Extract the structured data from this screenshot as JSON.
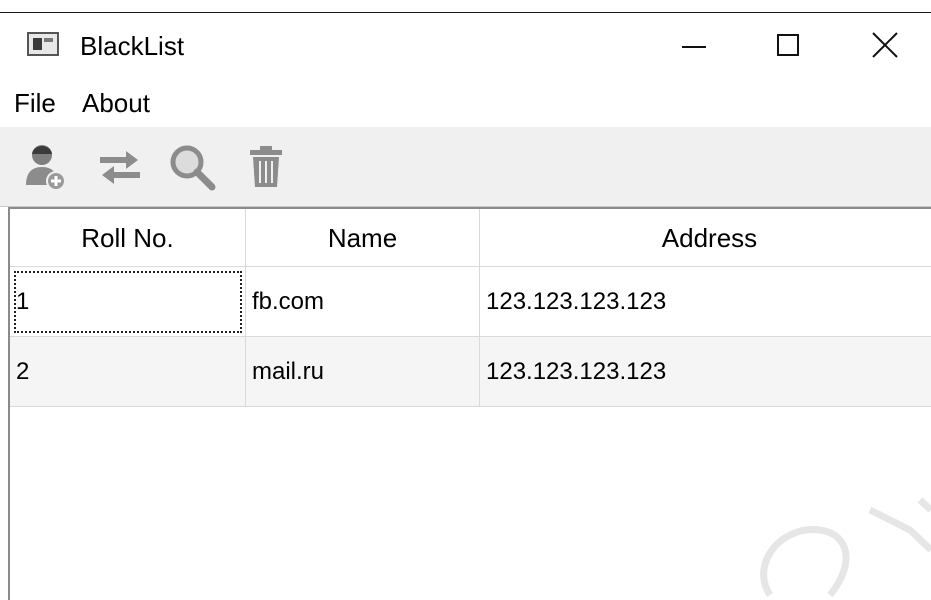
{
  "window": {
    "title": "BlackList",
    "app_icon": "app-window-icon",
    "controls": {
      "minimize_icon": "minimize-icon",
      "maximize_icon": "maximize-icon",
      "close_icon": "close-icon"
    }
  },
  "menubar": {
    "items": [
      {
        "label": "File"
      },
      {
        "label": "About"
      }
    ]
  },
  "toolbar": {
    "buttons": [
      {
        "icon": "add-user-icon"
      },
      {
        "icon": "swap-arrows-icon"
      },
      {
        "icon": "search-icon"
      },
      {
        "icon": "trash-icon"
      }
    ]
  },
  "table": {
    "columns": [
      "Roll No.",
      "Name",
      "Address"
    ],
    "rows": [
      {
        "roll": "1",
        "name": "fb.com",
        "address": "123.123.123.123"
      },
      {
        "roll": "2",
        "name": "mail.ru",
        "address": "123.123.123.123"
      }
    ],
    "focused_cell": "rows.0.roll"
  },
  "colors": {
    "toolbar_bg": "#f0f0f0",
    "alt_row_bg": "#f5f5f5",
    "grid_line": "#d9d9d9",
    "icon_gray": "#8c8c8c"
  }
}
